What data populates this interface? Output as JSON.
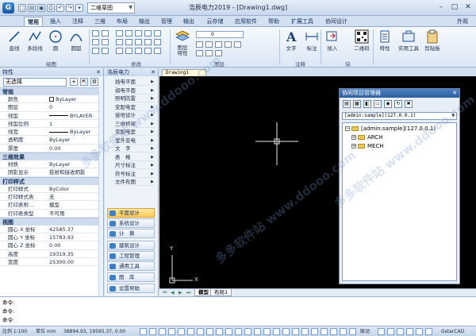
{
  "titlebar": {
    "title": "浩辰电力2019 - [Drawing1.dwg]",
    "workspace": "二维草图",
    "appearance": "外观"
  },
  "tabs": [
    "常用",
    "插入",
    "注释",
    "三维",
    "布局",
    "输出",
    "管理",
    "输出",
    "云存储",
    "应用软件",
    "帮助",
    "扩展工具",
    "协同设计"
  ],
  "ribbon": {
    "draw_buttons": [
      "直线",
      "多段线",
      "圆",
      "圆弧"
    ],
    "draw_group": "绘图",
    "modify_group": "修改",
    "layer_group": "图层",
    "layer_label": "图层\n特性",
    "layer_value": "0",
    "annotation_group": "注释",
    "annotation_buttons": [
      "文字",
      "标注"
    ],
    "block_group": "块",
    "block_buttons": [
      "插入",
      "二维码"
    ],
    "right_buttons": [
      "特性",
      "实用工具",
      "剪贴板"
    ]
  },
  "props": {
    "title": "特性",
    "selection": "无选择",
    "sections": {
      "general": "常规",
      "three_d": "三维效果",
      "print": "打印样式",
      "view": "视图"
    },
    "general_rows": [
      {
        "k": "颜色",
        "v": "ByLayer"
      },
      {
        "k": "图层",
        "v": "0"
      },
      {
        "k": "线型",
        "v": "BYLAYER"
      },
      {
        "k": "线型比例",
        "v": "1"
      },
      {
        "k": "线宽",
        "v": "ByLayer"
      },
      {
        "k": "透明度",
        "v": "ByLayer"
      },
      {
        "k": "厚度",
        "v": "0.00"
      }
    ],
    "three_d_rows": [
      {
        "k": "材质",
        "v": "ByLayer"
      },
      {
        "k": "阴影显示",
        "v": "投射和接收阴影"
      }
    ],
    "print_rows": [
      {
        "k": "打印样式",
        "v": "ByColor"
      },
      {
        "k": "打印样式表",
        "v": "无"
      },
      {
        "k": "打印表附...",
        "v": "模型"
      },
      {
        "k": "打印表类型",
        "v": "不可用"
      }
    ],
    "view_rows": [
      {
        "k": "圆心 X 坐标",
        "v": "42585.37"
      },
      {
        "k": "圆心 Y 坐标",
        "v": "15783.93"
      },
      {
        "k": "圆心 Z 坐标",
        "v": "0.00"
      },
      {
        "k": "高度",
        "v": "19319.35"
      },
      {
        "k": "宽度",
        "v": "25300.00"
      }
    ]
  },
  "toolpanel": {
    "title": "浩辰电力",
    "menus": [
      "插电平面",
      "弱电平面",
      "照明防雷",
      "变配电室",
      "接地设计",
      "三维桥架",
      "变配电室",
      "室外变电",
      "文　字",
      "表　格",
      "尺寸标注",
      "符号标注",
      "文件布图"
    ],
    "categories": [
      "平面设计",
      "系统设计",
      "计　算",
      "建筑设计",
      "工程管理",
      "通用工具",
      "图　库",
      "设置帮助"
    ]
  },
  "drawing": {
    "tab": "Drawing1",
    "layout_tabs": [
      "模型",
      "布局1"
    ],
    "ucs_x": "X",
    "ucs_y": "Y"
  },
  "collab": {
    "title": "协同项目管理器",
    "server": "[admin:sample](127.0.0.1)",
    "tree_root": "[admin:sample](127.0.0.1)",
    "tree_children": [
      "ARCH",
      "MECH"
    ]
  },
  "command": {
    "lines": [
      "命令:",
      "命令:",
      "命令:"
    ]
  },
  "status": {
    "scale": "比例 1:100",
    "unit": "单位 mm",
    "coords": "38894.93, 19595.37, 0.00",
    "link": "联动",
    "brand": "GstarCAD"
  },
  "watermark": "多多软件站 www.ddooo.com"
}
